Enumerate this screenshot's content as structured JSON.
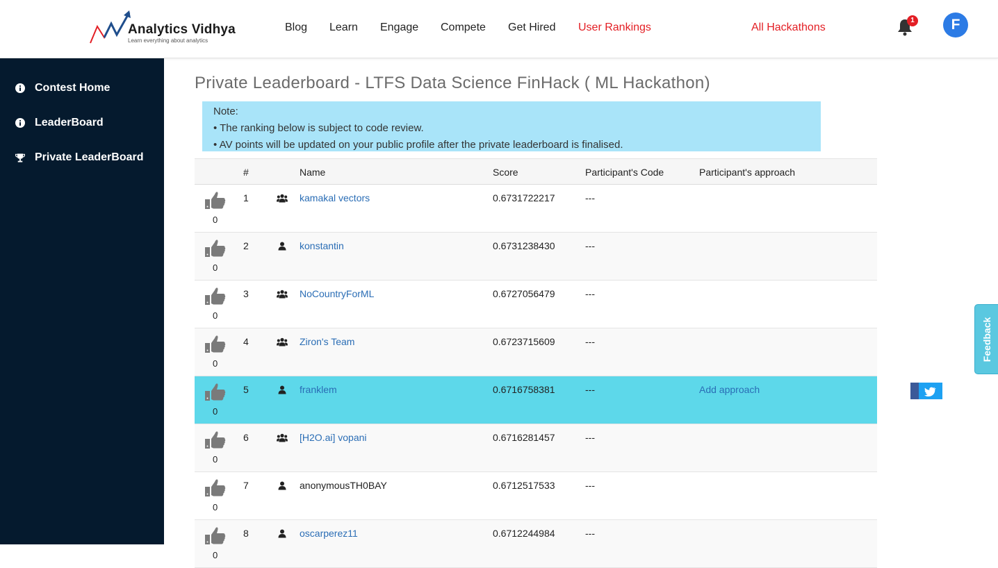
{
  "header": {
    "logo_title": "Analytics Vidhya",
    "logo_tagline": "Learn everything about analytics",
    "nav": [
      {
        "label": "Blog"
      },
      {
        "label": "Learn"
      },
      {
        "label": "Engage"
      },
      {
        "label": "Compete"
      },
      {
        "label": "Get Hired"
      },
      {
        "label": "User Rankings"
      },
      {
        "label": "All Hackathons"
      }
    ],
    "notification_count": "1",
    "avatar_letter": "F"
  },
  "sidebar": {
    "items": [
      {
        "label": "Contest Home",
        "icon": "info-icon"
      },
      {
        "label": "LeaderBoard",
        "icon": "info-icon"
      },
      {
        "label": "Private LeaderBoard",
        "icon": "trophy-icon"
      }
    ]
  },
  "main": {
    "title": "Private Leaderboard - LTFS Data Science FinHack ( ML Hackathon)",
    "note": {
      "heading": "Note:",
      "lines": [
        "• The ranking below is subject to code review.",
        "• AV points will be updated on your public profile after the private leaderboard is finalised."
      ]
    },
    "table": {
      "headers": {
        "rank": "#",
        "name": "Name",
        "score": "Score",
        "code": "Participant's Code",
        "approach": "Participant's approach"
      },
      "rows": [
        {
          "likes": "0",
          "rank": "1",
          "type": "team",
          "name": "kamakal vectors",
          "score": "0.6731722217",
          "code": "---",
          "approach": ""
        },
        {
          "likes": "0",
          "rank": "2",
          "type": "user",
          "name": "konstantin",
          "score": "0.6731238430",
          "code": "---",
          "approach": ""
        },
        {
          "likes": "0",
          "rank": "3",
          "type": "team",
          "name": "NoCountryForML",
          "score": "0.6727056479",
          "code": "---",
          "approach": ""
        },
        {
          "likes": "0",
          "rank": "4",
          "type": "team",
          "name": "Ziron's Team",
          "score": "0.6723715609",
          "code": "---",
          "approach": ""
        },
        {
          "likes": "0",
          "rank": "5",
          "type": "user",
          "name": "franklem",
          "score": "0.6716758381",
          "code": "---",
          "approach": "Add approach"
        },
        {
          "likes": "0",
          "rank": "6",
          "type": "team",
          "name": "[H2O.ai] vopani",
          "score": "0.6716281457",
          "code": "---",
          "approach": ""
        },
        {
          "likes": "0",
          "rank": "7",
          "type": "user",
          "name": "anonymousTH0BAY",
          "score": "0.6712517533",
          "code": "---",
          "approach": ""
        },
        {
          "likes": "0",
          "rank": "8",
          "type": "user",
          "name": "oscarperez11",
          "score": "0.6712244984",
          "code": "---",
          "approach": ""
        }
      ]
    }
  },
  "feedback_label": "Feedback",
  "colors": {
    "sidebar_bg": "#051a2e",
    "highlight_row": "#5dd8ea",
    "note_bg": "#a9e4f9",
    "link": "#2a6db5",
    "accent_red": "#e31e24"
  }
}
